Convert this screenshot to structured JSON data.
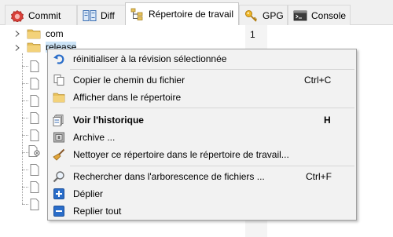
{
  "tabs": [
    {
      "label": "Commit",
      "icon": "commit-icon",
      "active": false
    },
    {
      "label": "Diff",
      "icon": "diff-icon",
      "active": false
    },
    {
      "label": "Répertoire de travail",
      "icon": "working-tree-icon",
      "active": true
    },
    {
      "label": "GPG",
      "icon": "key-icon",
      "active": false
    },
    {
      "label": "Console",
      "icon": "console-icon",
      "active": false
    }
  ],
  "tree": {
    "items": [
      {
        "label": "com",
        "type": "folder",
        "expanded": false
      },
      {
        "label": "release",
        "type": "folder",
        "expanded": false
      }
    ]
  },
  "line_number": "1",
  "context_menu": {
    "items": [
      {
        "label": "réinitialiser à la révision sélectionnée",
        "icon": "undo-icon",
        "shortcut": ""
      },
      {
        "label": "Copier le chemin du fichier",
        "icon": "copy-icon",
        "shortcut": "Ctrl+C"
      },
      {
        "label": "Afficher dans le répertoire",
        "icon": "folder-icon",
        "shortcut": ""
      },
      {
        "label": "Voir l'historique",
        "icon": "history-icon",
        "shortcut": "H",
        "bold": true
      },
      {
        "label": "Archive ...",
        "icon": "archive-icon",
        "shortcut": ""
      },
      {
        "label": "Nettoyer ce répertoire dans le répertoire de travail...",
        "icon": "broom-icon",
        "shortcut": ""
      },
      {
        "label": "Rechercher dans l'arborescence de fichiers ...",
        "icon": "search-icon",
        "shortcut": "Ctrl+F"
      },
      {
        "label": "Déplier",
        "icon": "expand-icon",
        "shortcut": ""
      },
      {
        "label": "Replier tout",
        "icon": "collapse-icon",
        "shortcut": ""
      }
    ]
  },
  "colors": {
    "accent_blue": "#2a6dc9",
    "folder_yellow": "#e8c15a",
    "commit_red": "#d9413a"
  }
}
